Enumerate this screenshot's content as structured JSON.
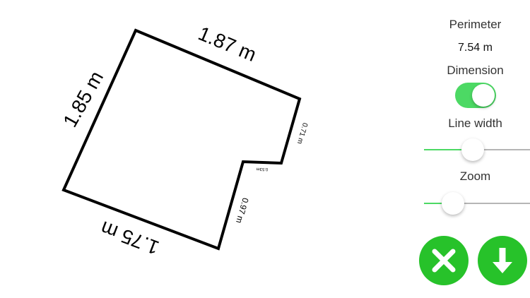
{
  "shape": {
    "segments": [
      {
        "label": "1.87 m"
      },
      {
        "label": "0.71 m"
      },
      {
        "label": "0.53m"
      },
      {
        "label": "0.97 m"
      },
      {
        "label": "1.75 m"
      },
      {
        "label": "1.85 m"
      }
    ],
    "line_color": "#000000"
  },
  "panel": {
    "perimeter_label": "Perimeter",
    "perimeter_value": "7.54 m",
    "dimension_label": "Dimension",
    "dimension_on": true,
    "line_width_label": "Line width",
    "line_width_level": 0.46,
    "zoom_label": "Zoom",
    "zoom_level": 0.27
  },
  "buttons": {
    "cancel_icon": "close-icon",
    "download_icon": "arrow-down-icon"
  },
  "colors": {
    "accent_green": "#4cd964",
    "button_green": "#27c22a",
    "track_gray": "#b5b5b5"
  }
}
